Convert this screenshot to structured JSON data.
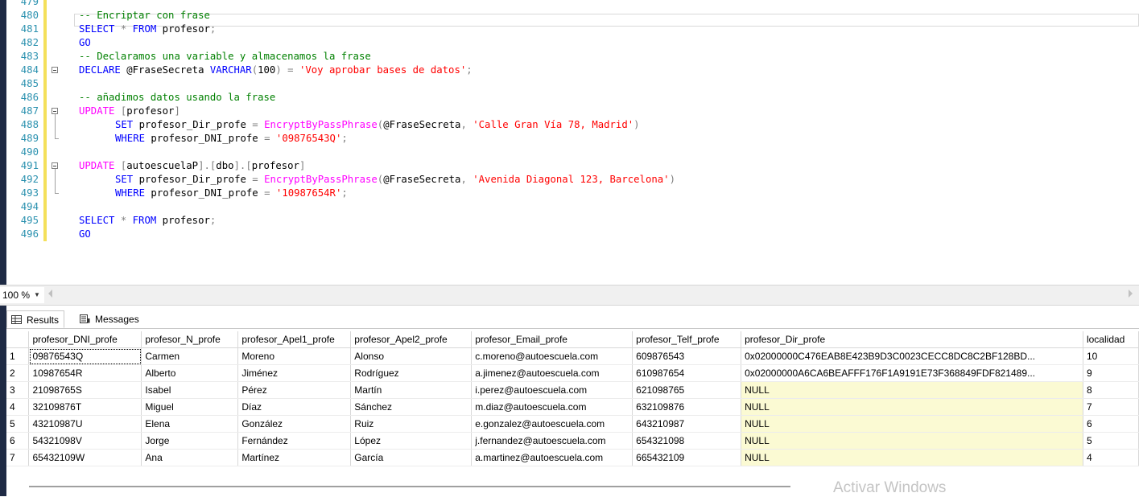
{
  "editor": {
    "lines": [
      {
        "n": "479",
        "t": []
      },
      {
        "n": "480",
        "t": [
          {
            "c": "cm",
            "s": "-- Encriptar con frase"
          }
        ]
      },
      {
        "n": "481",
        "t": [
          {
            "c": "kw",
            "s": "SELECT"
          },
          {
            "c": "tx",
            "s": " "
          },
          {
            "c": "op",
            "s": "*"
          },
          {
            "c": "tx",
            "s": " "
          },
          {
            "c": "kw",
            "s": "FROM"
          },
          {
            "c": "tx",
            "s": " profesor"
          },
          {
            "c": "op",
            "s": ";"
          }
        ]
      },
      {
        "n": "482",
        "t": [
          {
            "c": "kw",
            "s": "GO"
          }
        ]
      },
      {
        "n": "483",
        "t": [
          {
            "c": "cm",
            "s": "-- Declaramos una variable y almacenamos la frase"
          }
        ]
      },
      {
        "n": "484",
        "t": [
          {
            "c": "kw",
            "s": "DECLARE"
          },
          {
            "c": "tx",
            "s": " @FraseSecreta "
          },
          {
            "c": "kw",
            "s": "VARCHAR"
          },
          {
            "c": "op",
            "s": "("
          },
          {
            "c": "tx",
            "s": "100"
          },
          {
            "c": "op",
            "s": ")"
          },
          {
            "c": "tx",
            "s": " "
          },
          {
            "c": "op",
            "s": "="
          },
          {
            "c": "tx",
            "s": " "
          },
          {
            "c": "str",
            "s": "'Voy aprobar bases de datos'"
          },
          {
            "c": "op",
            "s": ";"
          }
        ]
      },
      {
        "n": "485",
        "t": []
      },
      {
        "n": "486",
        "t": [
          {
            "c": "cm",
            "s": "-- añadimos datos usando la frase"
          }
        ]
      },
      {
        "n": "487",
        "t": [
          {
            "c": "fn",
            "s": "UPDATE"
          },
          {
            "c": "tx",
            "s": " "
          },
          {
            "c": "op",
            "s": "["
          },
          {
            "c": "tx",
            "s": "profesor"
          },
          {
            "c": "op",
            "s": "]"
          }
        ]
      },
      {
        "n": "488",
        "t": [
          {
            "c": "kw",
            "s": "SET"
          },
          {
            "c": "tx",
            "s": " profesor_Dir_profe "
          },
          {
            "c": "op",
            "s": "="
          },
          {
            "c": "tx",
            "s": " "
          },
          {
            "c": "fn",
            "s": "EncryptByPassPhrase"
          },
          {
            "c": "op",
            "s": "("
          },
          {
            "c": "tx",
            "s": "@FraseSecreta"
          },
          {
            "c": "op",
            "s": ","
          },
          {
            "c": "tx",
            "s": " "
          },
          {
            "c": "str",
            "s": "'Calle Gran Vía 78, Madrid'"
          },
          {
            "c": "op",
            "s": ")"
          }
        ]
      },
      {
        "n": "489",
        "t": [
          {
            "c": "kw",
            "s": "WHERE"
          },
          {
            "c": "tx",
            "s": " profesor_DNI_profe "
          },
          {
            "c": "op",
            "s": "="
          },
          {
            "c": "tx",
            "s": " "
          },
          {
            "c": "str",
            "s": "'09876543Q'"
          },
          {
            "c": "op",
            "s": ";"
          }
        ]
      },
      {
        "n": "490",
        "t": []
      },
      {
        "n": "491",
        "t": [
          {
            "c": "fn",
            "s": "UPDATE"
          },
          {
            "c": "tx",
            "s": " "
          },
          {
            "c": "op",
            "s": "["
          },
          {
            "c": "tx",
            "s": "autoescuelaP"
          },
          {
            "c": "op",
            "s": "].["
          },
          {
            "c": "tx",
            "s": "dbo"
          },
          {
            "c": "op",
            "s": "].["
          },
          {
            "c": "tx",
            "s": "profesor"
          },
          {
            "c": "op",
            "s": "]"
          }
        ]
      },
      {
        "n": "492",
        "t": [
          {
            "c": "kw",
            "s": "SET"
          },
          {
            "c": "tx",
            "s": " profesor_Dir_profe "
          },
          {
            "c": "op",
            "s": "="
          },
          {
            "c": "tx",
            "s": " "
          },
          {
            "c": "fn",
            "s": "EncryptByPassPhrase"
          },
          {
            "c": "op",
            "s": "("
          },
          {
            "c": "tx",
            "s": "@FraseSecreta"
          },
          {
            "c": "op",
            "s": ","
          },
          {
            "c": "tx",
            "s": " "
          },
          {
            "c": "str",
            "s": "'Avenida Diagonal 123, Barcelona'"
          },
          {
            "c": "op",
            "s": ")"
          }
        ]
      },
      {
        "n": "493",
        "t": [
          {
            "c": "kw",
            "s": "WHERE"
          },
          {
            "c": "tx",
            "s": " profesor_DNI_profe "
          },
          {
            "c": "op",
            "s": "="
          },
          {
            "c": "tx",
            "s": " "
          },
          {
            "c": "str",
            "s": "'10987654R'"
          },
          {
            "c": "op",
            "s": ";"
          }
        ]
      },
      {
        "n": "494",
        "t": []
      },
      {
        "n": "495",
        "t": [
          {
            "c": "kw",
            "s": "SELECT"
          },
          {
            "c": "tx",
            "s": " "
          },
          {
            "c": "op",
            "s": "*"
          },
          {
            "c": "tx",
            "s": " "
          },
          {
            "c": "kw",
            "s": "FROM"
          },
          {
            "c": "tx",
            "s": " profesor"
          },
          {
            "c": "op",
            "s": ";"
          }
        ]
      },
      {
        "n": "496",
        "t": [
          {
            "c": "kw",
            "s": "GO"
          }
        ]
      }
    ]
  },
  "zoom": {
    "value": "100 %"
  },
  "tabs": {
    "results": "Results",
    "messages": "Messages"
  },
  "grid": {
    "columns": [
      "profesor_DNI_profe",
      "profesor_N_profe",
      "profesor_Apel1_profe",
      "profesor_Apel2_profe",
      "profesor_Email_profe",
      "profesor_Telf_profe",
      "profesor_Dir_profe",
      "localidad"
    ],
    "rows": [
      [
        "1",
        "09876543Q",
        "Carmen",
        "Moreno",
        "Alonso",
        "c.moreno@autoescuela.com",
        "609876543",
        "0x02000000C476EAB8E423B9D3C0023CECC8DC8C2BF128BD...",
        "10"
      ],
      [
        "2",
        "10987654R",
        "Alberto",
        "Jiménez",
        "Rodríguez",
        "a.jimenez@autoescuela.com",
        "610987654",
        "0x02000000A6CA6BEAFFF176F1A9191E73F368849FDF821489...",
        "9"
      ],
      [
        "3",
        "21098765S",
        "Isabel",
        "Pérez",
        "Martín",
        "i.perez@autoescuela.com",
        "621098765",
        "NULL",
        "8"
      ],
      [
        "4",
        "32109876T",
        "Miguel",
        "Díaz",
        "Sánchez",
        "m.diaz@autoescuela.com",
        "632109876",
        "NULL",
        "7"
      ],
      [
        "5",
        "43210987U",
        "Elena",
        "González",
        "Ruiz",
        "e.gonzalez@autoescuela.com",
        "643210987",
        "NULL",
        "6"
      ],
      [
        "6",
        "54321098V",
        "Jorge",
        "Fernández",
        "López",
        "j.fernandez@autoescuela.com",
        "654321098",
        "NULL",
        "5"
      ],
      [
        "7",
        "65432109W",
        "Ana",
        "Martínez",
        "García",
        "a.martinez@autoescuela.com",
        "665432109",
        "NULL",
        "4"
      ]
    ]
  },
  "watermark": "Activar Windows"
}
